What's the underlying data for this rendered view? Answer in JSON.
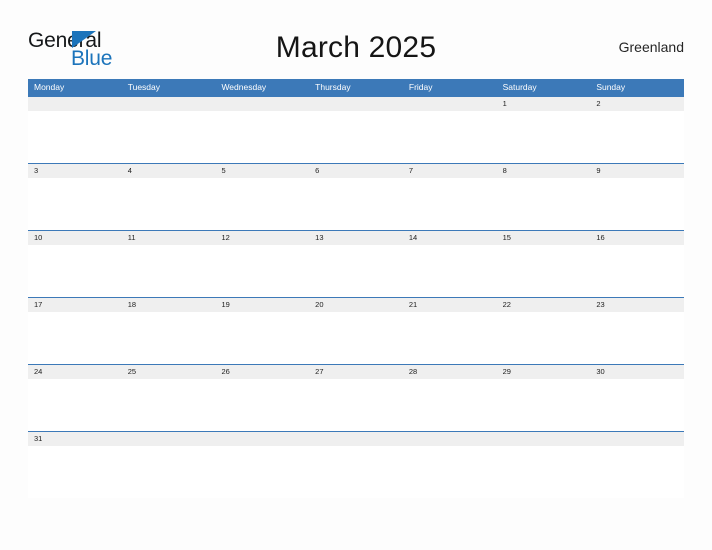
{
  "brand": {
    "name_part1": "General",
    "name_part2": "Blue",
    "triangle_color": "#1c74bb"
  },
  "header": {
    "title": "March 2025",
    "country": "Greenland"
  },
  "colors": {
    "header_blue": "#3c79b8",
    "date_band_gray": "#efefef",
    "page_background": "#fdfdfd",
    "brand_blue": "#1c74bb"
  },
  "calendar": {
    "month": "March",
    "year": "2025",
    "weekday_headers": [
      "Monday",
      "Tuesday",
      "Wednesday",
      "Thursday",
      "Friday",
      "Saturday",
      "Sunday"
    ],
    "weeks": [
      [
        "",
        "",
        "",
        "",
        "",
        "1",
        "2"
      ],
      [
        "3",
        "4",
        "5",
        "6",
        "7",
        "8",
        "9"
      ],
      [
        "10",
        "11",
        "12",
        "13",
        "14",
        "15",
        "16"
      ],
      [
        "17",
        "18",
        "19",
        "20",
        "21",
        "22",
        "23"
      ],
      [
        "24",
        "25",
        "26",
        "27",
        "28",
        "29",
        "30"
      ],
      [
        "31",
        "",
        "",
        "",
        "",
        "",
        ""
      ]
    ]
  }
}
